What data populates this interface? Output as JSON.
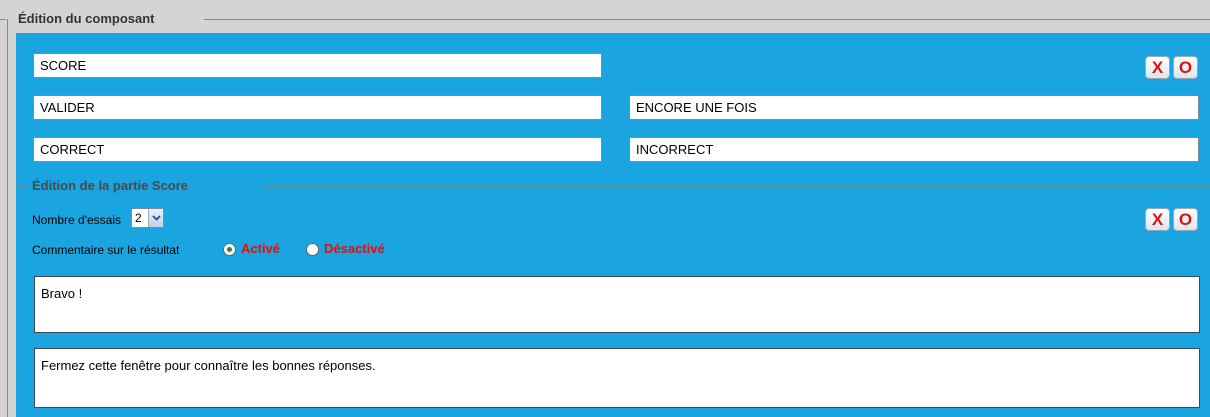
{
  "outer": {
    "title": "Édition du composant"
  },
  "fields": {
    "score": "SCORE",
    "valider": "VALIDER",
    "encore": "ENCORE UNE FOIS",
    "correct": "CORRECT",
    "incorrect": "INCORRECT"
  },
  "buttons": {
    "x_label": "X",
    "o_label": "O"
  },
  "score_section": {
    "title": "Édition de la partie Score",
    "attempts_label": "Nombre d'essais",
    "attempts_value": "2",
    "comment_label": "Commentaire sur le résultat",
    "option_on": "Activé",
    "option_off": "Désactivé",
    "selected_option": "Activé",
    "success_message": "Bravo !",
    "failure_message": "Fermez cette fenêtre pour connaître les bonnes réponses."
  },
  "colors": {
    "panel": "#1aa4e0",
    "accent_red": "#e01010"
  },
  "icons": {
    "select_arrow": "chevron-down-icon"
  }
}
